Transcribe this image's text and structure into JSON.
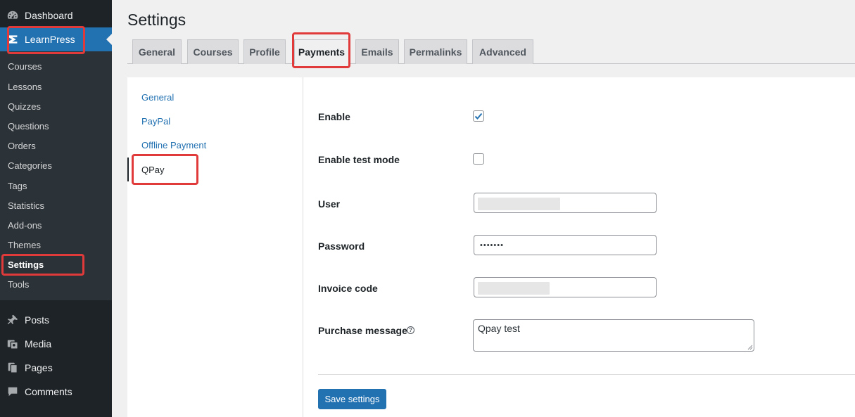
{
  "sidebar": {
    "dashboard": "Dashboard",
    "learnpress": "LearnPress",
    "submenu": [
      "Courses",
      "Lessons",
      "Quizzes",
      "Questions",
      "Orders",
      "Categories",
      "Tags",
      "Statistics",
      "Add-ons",
      "Themes",
      "Settings",
      "Tools"
    ],
    "current_submenu": "Settings",
    "posts": "Posts",
    "media": "Media",
    "pages": "Pages",
    "comments": "Comments"
  },
  "page": {
    "title": "Settings"
  },
  "tabs": [
    "General",
    "Courses",
    "Profile",
    "Payments",
    "Emails",
    "Permalinks",
    "Advanced"
  ],
  "active_tab": "Payments",
  "subnav": [
    "General",
    "PayPal",
    "Offline Payment",
    "QPay"
  ],
  "active_subnav": "QPay",
  "form": {
    "enable": {
      "label": "Enable",
      "checked": true
    },
    "test_mode": {
      "label": "Enable test mode",
      "checked": false
    },
    "user": {
      "label": "User",
      "value": ""
    },
    "password": {
      "label": "Password",
      "value": "•••••••"
    },
    "invoice_code": {
      "label": "Invoice code",
      "value": ""
    },
    "purchase_message": {
      "label": "Purchase message",
      "value": "Qpay test"
    }
  },
  "save_label": "Save settings",
  "colors": {
    "accent": "#2271b1",
    "sidebar_bg": "#1d2327",
    "highlight": "#e03a3a"
  }
}
